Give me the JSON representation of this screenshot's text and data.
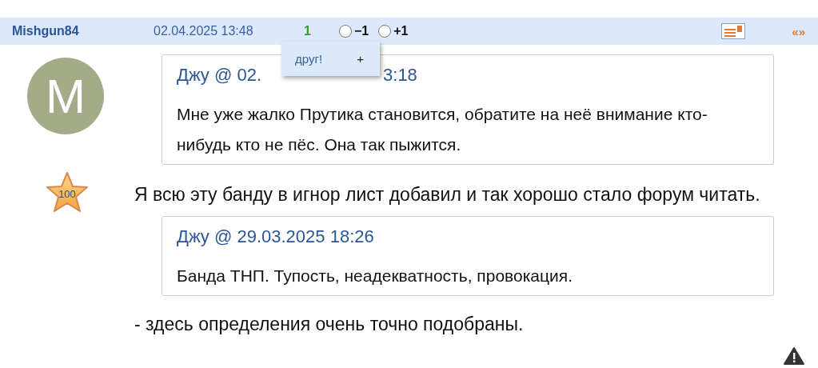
{
  "post_header": {
    "username": "Mishgun84",
    "datetime": "02.04.2025 13:48",
    "rating": "1",
    "votes": [
      {
        "label": "−1",
        "selected": false
      },
      {
        "label": "+1",
        "selected": false
      }
    ],
    "popup": {
      "label": "друг!",
      "action": "+"
    },
    "nav": "«»"
  },
  "author": {
    "avatar_letter": "M",
    "badge": "100"
  },
  "content": [
    {
      "kind": "quote",
      "author": "Джу @",
      "date_start": "02.",
      "date_end": "3:18",
      "text": "Мне уже жалко Прутика становится, обратите на неё внимание кто-нибудь кто не пёс. Она так пыжится."
    },
    {
      "kind": "text",
      "text": "Я всю эту банду в игнор лист добавил и так хорошо стало форум читать."
    },
    {
      "kind": "quote",
      "author": "Джу @",
      "date_start": "29.03.2025 18:26",
      "text": "Банда ТНП. Тупость, неадекватность, провокация."
    },
    {
      "kind": "text",
      "text": "- здесь определения очень точно подобраны."
    }
  ]
}
